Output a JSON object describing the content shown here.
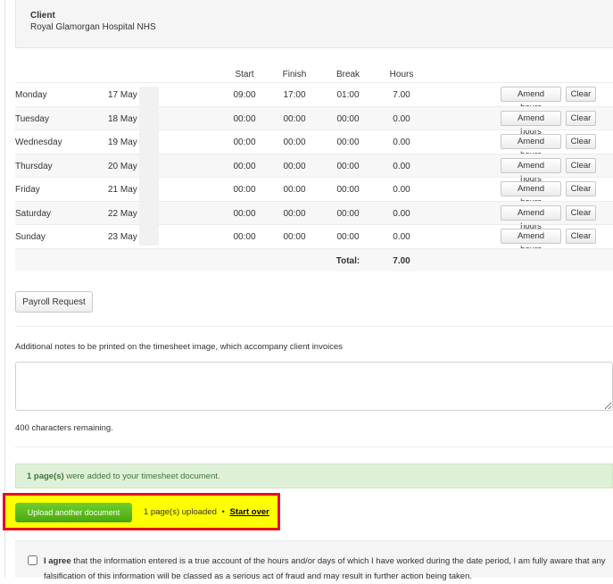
{
  "client": {
    "label": "Client",
    "name": "Royal Glamorgan Hospital NHS"
  },
  "table": {
    "headers": {
      "start": "Start",
      "finish": "Finish",
      "break": "Break",
      "hours": "Hours"
    },
    "rows": [
      {
        "day": "Monday",
        "date": "17 May",
        "start": "09:00",
        "finish": "17:00",
        "break": "01:00",
        "hours": "7.00"
      },
      {
        "day": "Tuesday",
        "date": "18 May",
        "start": "00:00",
        "finish": "00:00",
        "break": "00:00",
        "hours": "0.00"
      },
      {
        "day": "Wednesday",
        "date": "19 May",
        "start": "00:00",
        "finish": "00:00",
        "break": "00:00",
        "hours": "0.00"
      },
      {
        "day": "Thursday",
        "date": "20 May",
        "start": "00:00",
        "finish": "00:00",
        "break": "00:00",
        "hours": "0.00"
      },
      {
        "day": "Friday",
        "date": "21 May",
        "start": "00:00",
        "finish": "00:00",
        "break": "00:00",
        "hours": "0.00"
      },
      {
        "day": "Saturday",
        "date": "22 May",
        "start": "00:00",
        "finish": "00:00",
        "break": "00:00",
        "hours": "0.00"
      },
      {
        "day": "Sunday",
        "date": "23 May",
        "start": "00:00",
        "finish": "00:00",
        "break": "00:00",
        "hours": "0.00"
      }
    ],
    "amend_label": "Amend hours",
    "clear_label": "Clear",
    "total_label": "Total:",
    "total_hours": "7.00"
  },
  "payroll_button": "Payroll Request",
  "notes": {
    "label": "Additional notes to be printed on the timesheet image, which accompany client invoices",
    "value": "",
    "chars_remaining": "400 characters remaining."
  },
  "success": {
    "count": "1 page(s)",
    "message": " were added to your timesheet document."
  },
  "upload": {
    "button_label": "Upload another document",
    "status": "1 page(s) uploaded",
    "separator": "•",
    "start_over": "Start over"
  },
  "agree": {
    "lead": "I agree",
    "text": " that the information entered is a true account of the hours and/or days of which I have worked during the date period, I am fully aware that any falsification of this information will be classed as a serious act of fraud and may result in further action being taken."
  },
  "colors": {
    "upload_button": "#5bb81d",
    "highlight": "#ffff00",
    "highlight_border": "#e8101a",
    "success_bg": "#dff0d8"
  }
}
